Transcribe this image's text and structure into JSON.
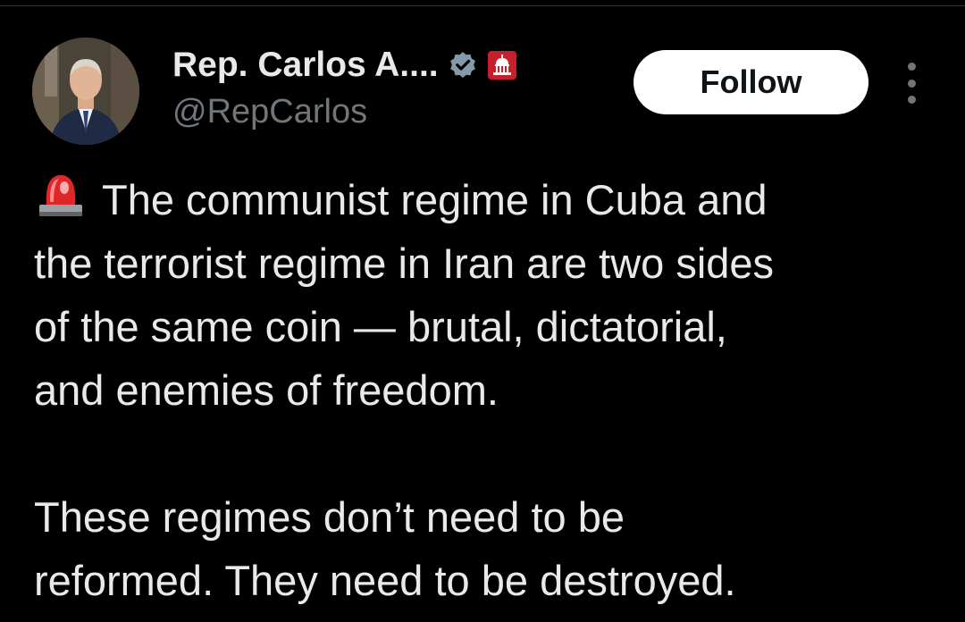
{
  "author": {
    "display_name": "Rep. Carlos A....",
    "handle": "@RepCarlos",
    "avatar_icon": "person-portrait-avatar",
    "verified_icon": "verified-badge-icon",
    "affiliation_icon": "capitol-affiliation-icon"
  },
  "actions": {
    "follow_label": "Follow",
    "more_icon": "more-options-icon"
  },
  "tweet": {
    "leading_icon": "police-siren-emoji",
    "paragraph_1": "The communist regime in Cuba and\nthe terrorist regime in Iran are two sides\nof the same coin — brutal, dictatorial,\nand enemies of freedom.",
    "paragraph_2": "These regimes don’t need to be\nreformed. They need to be destroyed."
  },
  "colors": {
    "background": "#000000",
    "text_primary": "#e7e9ea",
    "text_secondary": "#71767b",
    "follow_bg": "#ffffff",
    "follow_text": "#0f1419",
    "siren_red": "#e0262b"
  }
}
